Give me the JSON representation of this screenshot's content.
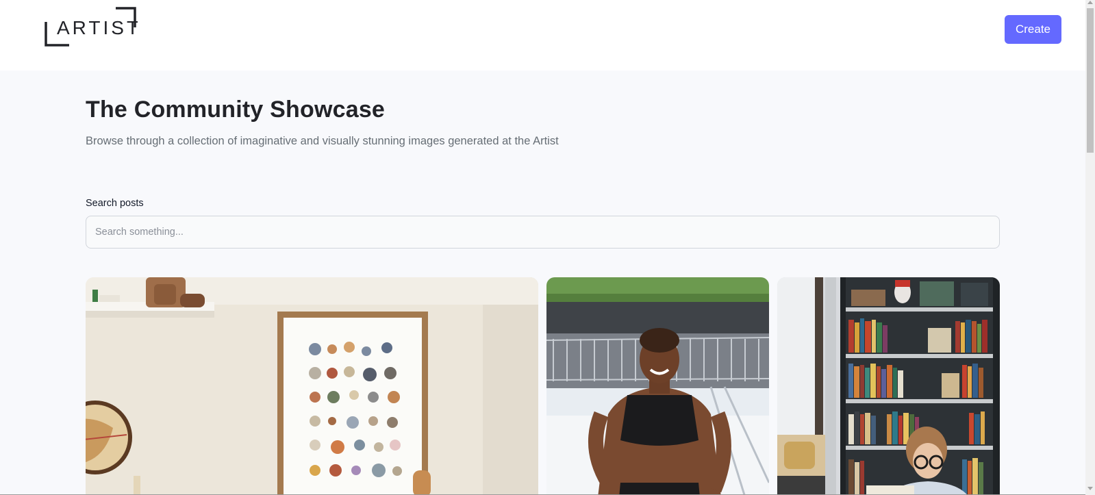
{
  "header": {
    "logo_text": "ARTIST",
    "create_label": "Create",
    "accent_color": "#6469ff"
  },
  "main": {
    "title": "The Community Showcase",
    "subtitle": "Browse through a collection of imaginative and visually stunning images generated at the Artist",
    "search": {
      "label": "Search posts",
      "placeholder": "Search something...",
      "value": ""
    }
  },
  "gallery": {
    "images": [
      {
        "subject": "nursery room with alphabet poster, shelf and globe"
      },
      {
        "subject": "smiling woman in black sports top running outdoors"
      },
      {
        "subject": "person with glasses in front of a bookshelf"
      }
    ]
  },
  "colors": {
    "page_background": "#f8f9fc",
    "header_background": "#ffffff",
    "title_color": "#222328",
    "subtitle_color": "#666e75"
  }
}
